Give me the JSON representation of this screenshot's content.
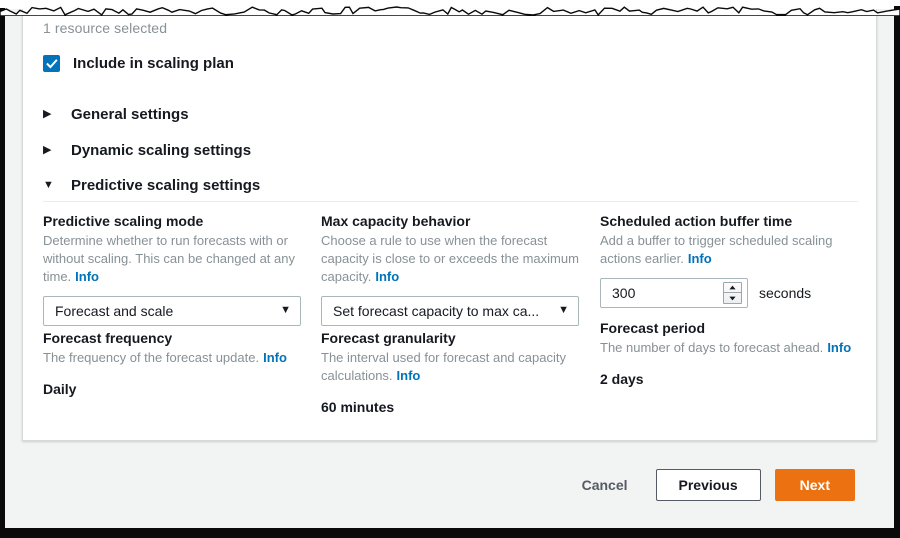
{
  "card": {
    "resource_count": "1 resource selected",
    "include_checkbox": {
      "label": "Include in scaling plan",
      "checked": true,
      "accent_color": "#0073bb"
    },
    "sections": [
      {
        "title": "General settings",
        "expanded": false,
        "icon": "triangle-right-icon"
      },
      {
        "title": "Dynamic scaling settings",
        "expanded": false,
        "icon": "triangle-right-icon"
      },
      {
        "title": "Predictive scaling settings",
        "expanded": true,
        "icon": "triangle-down-icon"
      }
    ]
  },
  "fields": {
    "predictive_scaling_mode": {
      "label": "Predictive scaling mode",
      "description": "Determine whether to run forecasts with or without scaling. This can be changed at any time.",
      "info": "Info",
      "value": "Forecast and scale"
    },
    "max_capacity_behavior": {
      "label": "Max capacity behavior",
      "description": "Choose a rule to use when the forecast capacity is close to or exceeds the maximum capacity.",
      "info": "Info",
      "value": "Set forecast capacity to max ca..."
    },
    "scheduled_action_buffer_time": {
      "label": "Scheduled action buffer time",
      "description": "Add a buffer to trigger scheduled scaling actions earlier.",
      "info": "Info",
      "value": "300",
      "unit": "seconds"
    },
    "forecast_frequency": {
      "label": "Forecast frequency",
      "description": "The frequency of the forecast update.",
      "info": "Info",
      "value": "Daily"
    },
    "forecast_granularity": {
      "label": "Forecast granularity",
      "description": "The interval used for forecast and capacity calculations.",
      "info": "Info",
      "value": "60 minutes"
    },
    "forecast_period": {
      "label": "Forecast period",
      "description": "The number of days to forecast ahead.",
      "info": "Info",
      "value": "2 days"
    }
  },
  "footer": {
    "cancel_label": "Cancel",
    "previous_label": "Previous",
    "next_label": "Next",
    "primary_color": "#ec7211"
  }
}
